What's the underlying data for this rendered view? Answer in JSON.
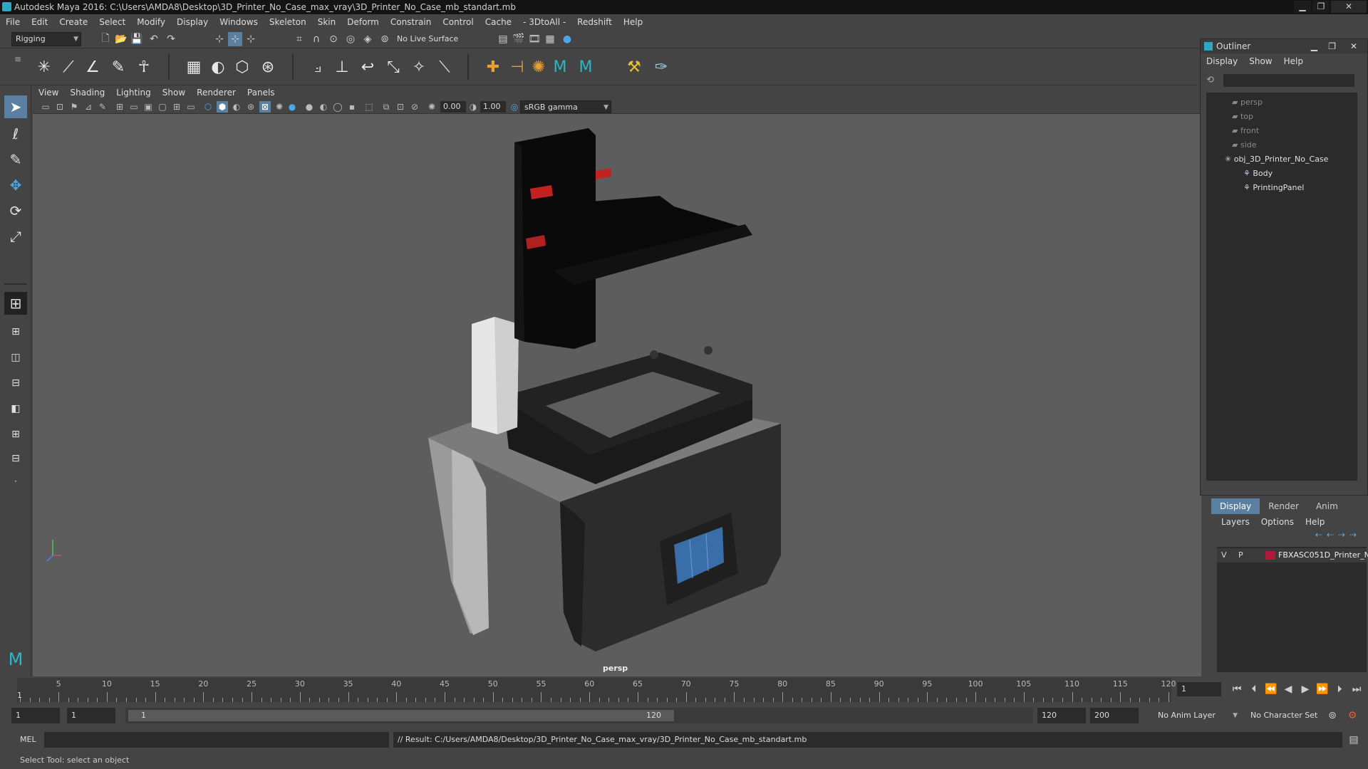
{
  "window": {
    "title": "Autodesk Maya 2016: C:\\Users\\AMDA8\\Desktop\\3D_Printer_No_Case_max_vray\\3D_Printer_No_Case_mb_standart.mb"
  },
  "menu": [
    "File",
    "Edit",
    "Create",
    "Select",
    "Modify",
    "Display",
    "Windows",
    "Skeleton",
    "Skin",
    "Deform",
    "Constrain",
    "Control",
    "Cache",
    "- 3DtoAll -",
    "Redshift",
    "Help"
  ],
  "status": {
    "menu_set": "Rigging",
    "live_surface": "No Live Surface"
  },
  "panel_menu": [
    "View",
    "Shading",
    "Lighting",
    "Show",
    "Renderer",
    "Panels"
  ],
  "panel_toolbar": {
    "exposure": "0.00",
    "gamma": "1.00",
    "color_space": "sRGB gamma"
  },
  "viewport": {
    "camera_label": "persp"
  },
  "outliner": {
    "title": "Outliner",
    "menu": [
      "Display",
      "Show",
      "Help"
    ],
    "items": [
      {
        "label": "persp",
        "dim": true
      },
      {
        "label": "top",
        "dim": true
      },
      {
        "label": "front",
        "dim": true
      },
      {
        "label": "side",
        "dim": true
      },
      {
        "label": "obj_3D_Printer_No_Case",
        "dim": false
      },
      {
        "label": "Body",
        "dim": false
      },
      {
        "label": "PrintingPanel",
        "dim": false
      }
    ]
  },
  "layers": {
    "tabs": [
      "Display",
      "Render",
      "Anim"
    ],
    "menu": [
      "Layers",
      "Options",
      "Help"
    ],
    "row": {
      "v": "V",
      "p": "P",
      "name": "FBXASC051D_Printer_N",
      "color": "#b01a3a"
    }
  },
  "timeline": {
    "ticks": [
      "5",
      "10",
      "15",
      "20",
      "25",
      "30",
      "35",
      "40",
      "45",
      "50",
      "55",
      "60",
      "65",
      "70",
      "75",
      "80",
      "85",
      "90",
      "95",
      "100",
      "105",
      "110",
      "115",
      "120"
    ],
    "start_tick": "1",
    "current_frame": "1"
  },
  "range": {
    "start": "1",
    "start2": "1",
    "slider_start": "1",
    "slider_end": "120",
    "end": "120",
    "end2": "200",
    "anim_layer": "No Anim Layer",
    "char_set": "No Character Set"
  },
  "command": {
    "lang": "MEL",
    "result": "// Result: C:/Users/AMDA8/Desktop/3D_Printer_No_Case_max_vray/3D_Printer_No_Case_mb_standart.mb"
  },
  "help_line": "Select Tool: select an object"
}
